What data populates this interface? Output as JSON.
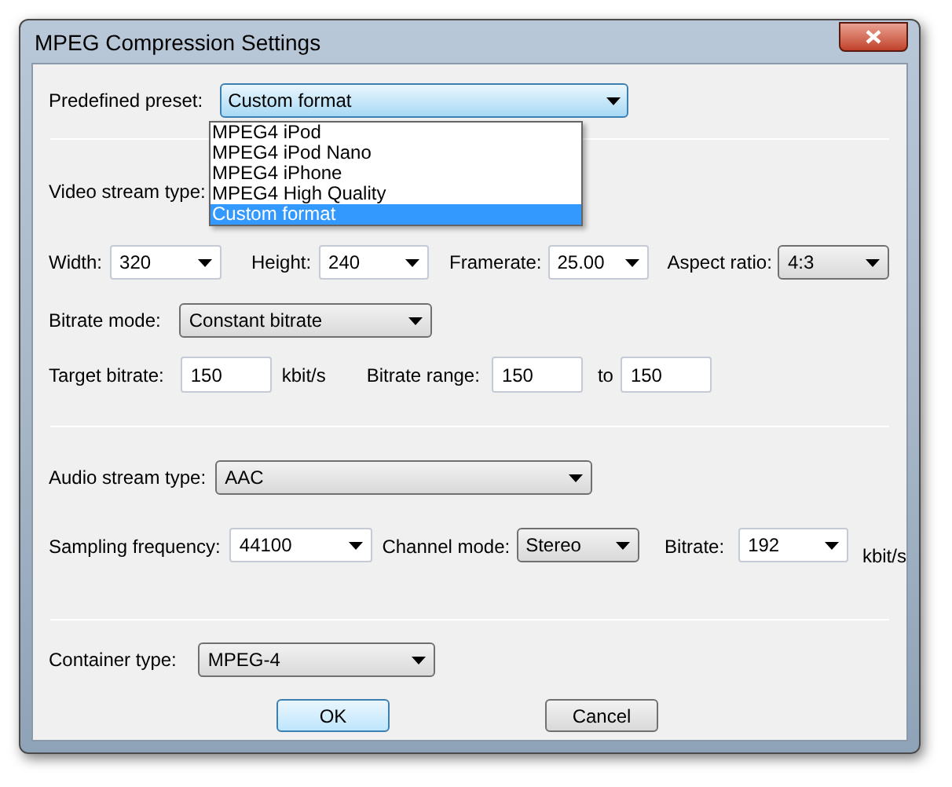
{
  "window": {
    "title": "MPEG Compression Settings"
  },
  "preset": {
    "label": "Predefined preset:",
    "value": "Custom format",
    "expanded": true,
    "options": [
      {
        "label": "MPEG4 iPod",
        "selected": false
      },
      {
        "label": "MPEG4 iPod Nano",
        "selected": false
      },
      {
        "label": "MPEG4 iPhone",
        "selected": false
      },
      {
        "label": "MPEG4 High Quality",
        "selected": false
      },
      {
        "label": "Custom format",
        "selected": true
      }
    ]
  },
  "video": {
    "stream_type_label": "Video stream type:",
    "width": {
      "label": "Width:",
      "value": "320",
      "kind": "editable"
    },
    "height": {
      "label": "Height:",
      "value": "240",
      "kind": "editable"
    },
    "framerate": {
      "label": "Framerate:",
      "value": "25.00",
      "kind": "editable"
    },
    "aspect_ratio": {
      "label": "Aspect ratio:",
      "value": "4:3",
      "kind": "dropdown"
    },
    "bitrate_mode": {
      "label": "Bitrate mode:",
      "value": "Constant bitrate",
      "kind": "dropdown"
    },
    "target_bitrate": {
      "label": "Target bitrate:",
      "value": "150",
      "unit": "kbit/s"
    },
    "bitrate_range": {
      "label": "Bitrate range:",
      "from": "150",
      "to_label": "to",
      "to": "150"
    }
  },
  "audio": {
    "stream_type": {
      "label": "Audio stream type:",
      "value": "AAC",
      "kind": "dropdown"
    },
    "sampling_frequency": {
      "label": "Sampling frequency:",
      "value": "44100",
      "kind": "editable"
    },
    "channel_mode": {
      "label": "Channel mode:",
      "value": "Stereo",
      "kind": "dropdown"
    },
    "bitrate": {
      "label": "Bitrate:",
      "value": "192",
      "kind": "editable",
      "unit": "kbit/s"
    }
  },
  "container": {
    "label": "Container type:",
    "value": "MPEG-4",
    "kind": "dropdown"
  },
  "buttons": [
    {
      "label": "OK",
      "default": true
    },
    {
      "label": "Cancel",
      "default": false
    }
  ]
}
